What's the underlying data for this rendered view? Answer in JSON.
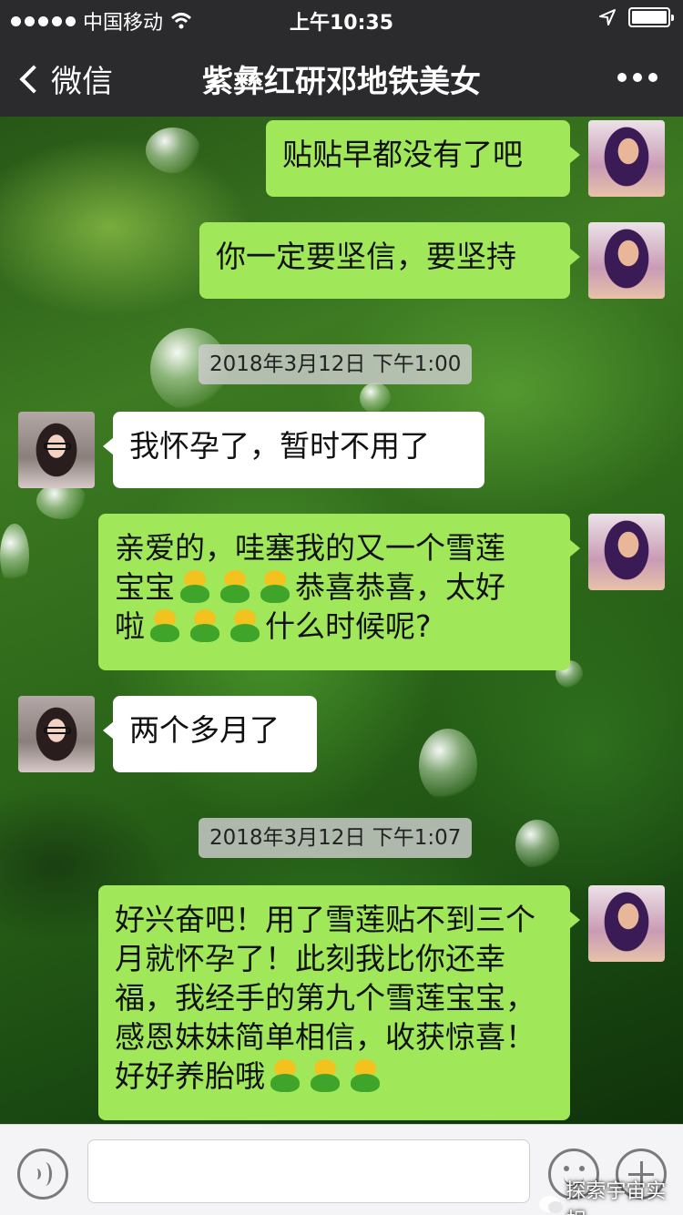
{
  "status_bar": {
    "carrier": "中国移动",
    "time": "上午10:35"
  },
  "nav": {
    "back_label": "微信",
    "title": "紫彝红研邓地铁美女"
  },
  "messages": [
    {
      "sender": "me",
      "text": "贴贴早都没有了吧"
    },
    {
      "sender": "me",
      "text": "你一定要坚信，要坚持"
    },
    {
      "type": "timestamp",
      "text": "2018年3月12日 下午1:00"
    },
    {
      "sender": "her",
      "text": "我怀孕了，暂时不用了"
    },
    {
      "sender": "me",
      "text_parts": [
        "亲爱的，哇塞我的又一个雪莲",
        "宝宝",
        "恭喜恭喜，太好",
        "啦",
        "什么时候呢?"
      ]
    },
    {
      "sender": "her",
      "text": "两个多月了"
    },
    {
      "type": "timestamp",
      "text": "2018年3月12日 下午1:07"
    },
    {
      "sender": "me",
      "text_parts": [
        "好兴奋吧！用了雪莲贴不到三个月就怀孕了！此刻我比你还幸福，我经手的第九个雪莲宝宝，感恩妹妹简单相信，收获惊喜！好好养胎哦"
      ]
    }
  ],
  "watermark": "探索宇宙实相",
  "icons": {
    "back": "chevron-left-icon",
    "more": "more-dots-icon",
    "voice": "voice-icon",
    "emoji": "emoji-icon",
    "plus": "plus-icon",
    "sticker": "baby-emoji-icon"
  },
  "colors": {
    "bar": "#2b2b2d",
    "my_bubble": "#a0e75a",
    "her_bubble": "#ffffff",
    "timestamp_bg": "#cdcdcd"
  }
}
